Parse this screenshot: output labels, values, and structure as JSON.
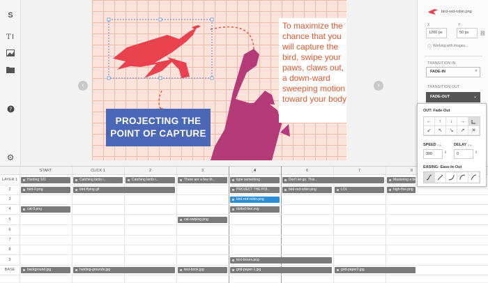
{
  "toolbar": {
    "items": [
      {
        "name": "logo-button",
        "glyph": "S"
      },
      {
        "name": "text-tool-icon",
        "glyph": "Tᴵ"
      },
      {
        "name": "image-tool-icon",
        "glyph": "▲"
      },
      {
        "name": "folder-icon",
        "glyph": "■"
      },
      {
        "name": "help-icon",
        "glyph": "?"
      },
      {
        "name": "settings-gear-icon",
        "glyph": "⚙"
      }
    ]
  },
  "canvas": {
    "textbox": "To maximize the chance that you will capture the bird, swipe your paws, claws out, in a down-ward sweeping motion toward your body.",
    "label_line1": "PROJECTING THE",
    "label_line2": "POINT OF CAPTURE",
    "prev_glyph": "‹",
    "next_glyph": "›",
    "bird_color": "#e8424f",
    "cat_color": "#b53a7a"
  },
  "panel": {
    "asset_name": "bird-red-robin.png",
    "x_label": "X",
    "y_label": "Y",
    "x_value": "1200 px",
    "y_value": "50 px",
    "working": "Working with images...",
    "transition_in_label": "TRANSITION IN",
    "transition_in_value": "FADE-IN",
    "transition_out_label": "TRANSITION OUT",
    "transition_out_value": "FADE-OUT"
  },
  "popover": {
    "out_title": "OUT: Fade-Out",
    "speed_label": "SPEED",
    "speed_unit": "ms",
    "speed_value": "300",
    "delay_label": "DELAY",
    "delay_unit": "ms",
    "delay_value": "0",
    "easing_title": "EASING: Ease-In-Out",
    "direction_glyphs": [
      "←",
      "↑",
      "↓",
      "→",
      "↙",
      "↖",
      "↘",
      "↗",
      "✕",
      "✕"
    ],
    "ease_glyphs": [
      "/",
      "/",
      "/",
      "/",
      "/"
    ]
  },
  "timeline": {
    "columns": [
      "START",
      "CLICK 1",
      "2",
      "3",
      "4",
      "6",
      "7",
      "8"
    ],
    "rows": [
      "LAYER 1",
      "2",
      "3",
      "4",
      "5",
      "6",
      "7",
      "8",
      "9",
      "BASE"
    ],
    "clips": {
      "r1": [
        "Hunting 101",
        "Catching birds i...",
        "Catching birds i...",
        "There are a few th...",
        "type something",
        "Don't let go. This...",
        "",
        "Mastering a bird..."
      ],
      "r2": [
        "bird-0.png",
        "bird-flying.gif",
        "PROJECT THE POI...",
        "bird-red-robin.png",
        "LOL",
        "high-five.png"
      ],
      "r3": [
        "bird-red-robin.png"
      ],
      "r4": [
        "cat-0.png",
        "dotted-line.svg"
      ],
      "r5": [
        "cat-swiping.png"
      ],
      "r9": [
        "text-boxes.png"
      ],
      "base": [
        "background.jpg",
        "hunting-grounds.jpg",
        "text-book.jpg",
        "grid-paper-1.jpg",
        "grid-paper2.jpg"
      ]
    },
    "selected_color": "#2a8fd6"
  }
}
